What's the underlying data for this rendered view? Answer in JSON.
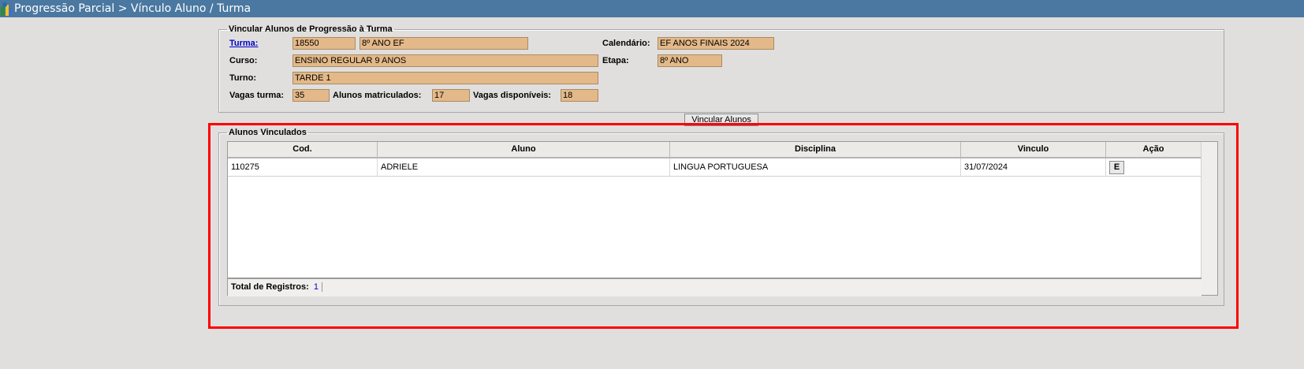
{
  "title_bar": {
    "breadcrumb": "Progressão Parcial > Vínculo Aluno / Turma"
  },
  "vincular_group": {
    "legend": "Vincular Alunos de Progressão à Turma",
    "turma_label": "Turma:",
    "turma_code": "18550",
    "turma_name": "8º ANO EF",
    "calendario_label": "Calendário:",
    "calendario_value": "EF ANOS FINAIS 2024",
    "curso_label": "Curso:",
    "curso_value": "ENSINO REGULAR 9 ANOS",
    "etapa_label": "Etapa:",
    "etapa_value": "8º ANO",
    "turno_label": "Turno:",
    "turno_value": "TARDE 1",
    "vagas_turma_label": "Vagas turma:",
    "vagas_turma_value": "35",
    "alunos_matriculados_label": "Alunos matriculados:",
    "alunos_matriculados_value": "17",
    "vagas_disponiveis_label": "Vagas disponíveis:",
    "vagas_disponiveis_value": "18"
  },
  "vincular_button": {
    "label": "Vincular Alunos"
  },
  "vinculados_group": {
    "legend": "Alunos Vinculados",
    "columns": [
      "Cod.",
      "Aluno",
      "Disciplina",
      "Vinculo",
      "Ação"
    ],
    "rows": [
      {
        "cod": "110275",
        "aluno": "ADRIELE",
        "disciplina": "LINGUA PORTUGUESA",
        "vinculo": "31/07/2024",
        "acao_label": "E"
      }
    ],
    "footer_label": "Total de Registros:",
    "footer_count": "1"
  },
  "colors": {
    "title_bar": "#4a78a0",
    "field_bg": "#e4b989",
    "highlight": "#ff0000",
    "link": "#0000cc"
  },
  "icons": {
    "app_logo": "app-logo-icon"
  }
}
